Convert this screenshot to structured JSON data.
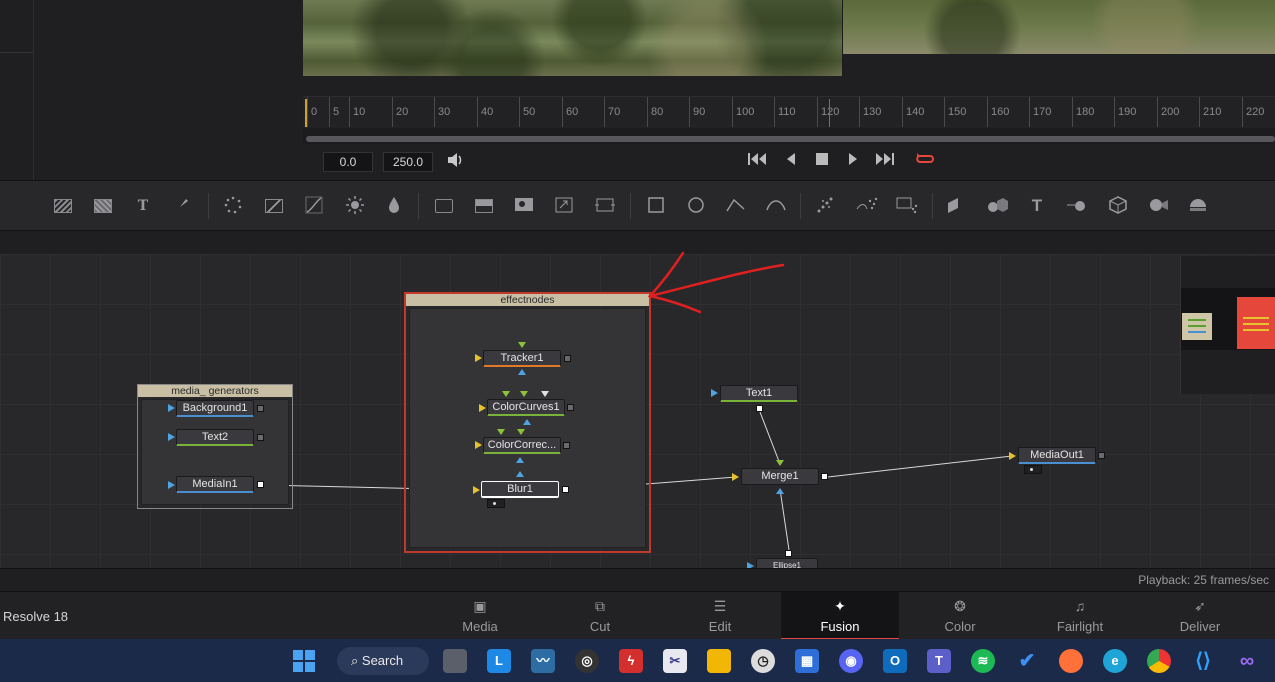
{
  "viewer": {
    "timecode_start": "0.0",
    "timecode_end": "250.0"
  },
  "ruler": {
    "ticks": [
      "0",
      "5",
      "10",
      "20",
      "30",
      "40",
      "50",
      "60",
      "70",
      "80",
      "90",
      "100",
      "110",
      "120",
      "130",
      "140",
      "150",
      "160",
      "170",
      "180",
      "190",
      "200",
      "210",
      "220"
    ]
  },
  "toolbar": {
    "tools": [
      "background",
      "fast-noise",
      "text",
      "paint",
      "particles",
      "color-curves",
      "curve",
      "brightness",
      "drop",
      "transform-2d",
      "merge",
      "mask-in",
      "resize",
      "transform",
      "rectangle",
      "ellipse",
      "polygon",
      "bspline",
      "particle-emitter",
      "particle-render",
      "particle-forces",
      "3d-plane",
      "3d-shapes",
      "3d-text",
      "3d-merge",
      "3d-cube",
      "3d-camera",
      "3d-light"
    ]
  },
  "graph": {
    "groups": [
      {
        "title": "media_ generators"
      },
      {
        "title": "effectnodes"
      }
    ],
    "nodes": {
      "background1": "Background1",
      "text2": "Text2",
      "mediain1": "MediaIn1",
      "tracker1": "Tracker1",
      "colorcurves1": "ColorCurves1",
      "colorcorrector": "ColorCorrec...",
      "blur1": "Blur1",
      "text1": "Text1",
      "merge1": "Merge1",
      "mediaout1": "MediaOut1",
      "ellipse1": "Ellipse1"
    }
  },
  "status": {
    "playback": "Playback: 25 frames/sec"
  },
  "pages": {
    "app_name": "Resolve 18",
    "items": [
      {
        "label": "Media"
      },
      {
        "label": "Cut"
      },
      {
        "label": "Edit"
      },
      {
        "label": "Fusion"
      },
      {
        "label": "Color"
      },
      {
        "label": "Fairlight"
      },
      {
        "label": "Deliver"
      }
    ]
  },
  "taskbar": {
    "search_label": "Search"
  },
  "colors": {
    "accent": "#e5483b",
    "selection_outline": "#c0392b",
    "annotation": "#e02020"
  }
}
